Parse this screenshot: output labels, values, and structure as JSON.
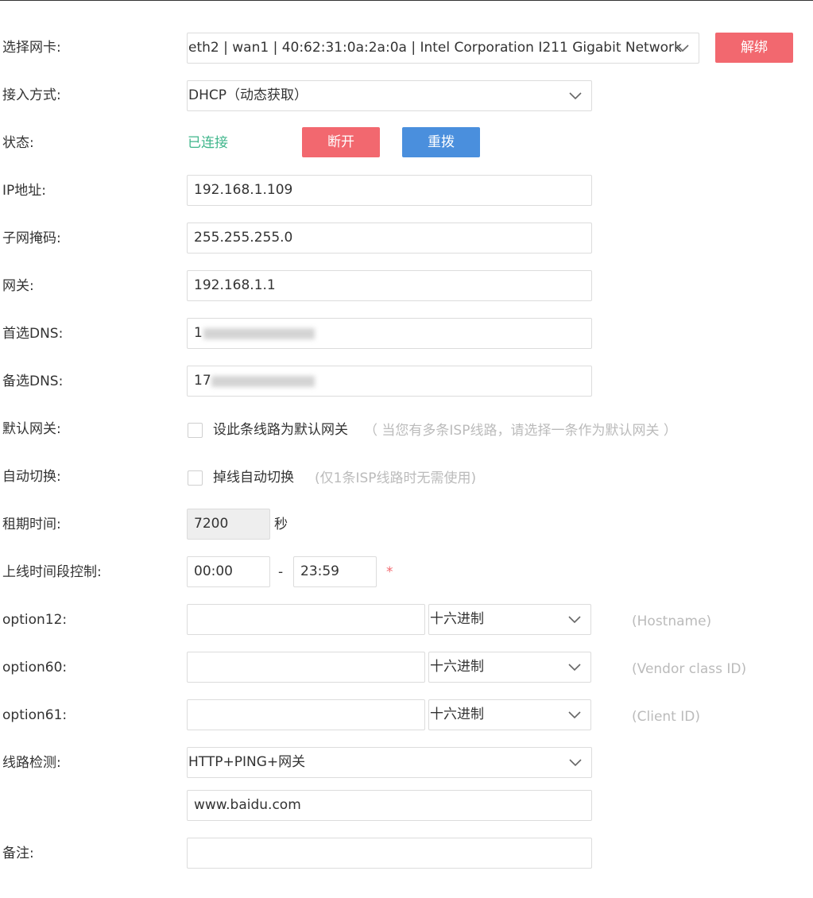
{
  "labels": {
    "nic": "选择网卡:",
    "access": "接入方式:",
    "status": "状态:",
    "ip": "IP地址:",
    "mask": "子网掩码:",
    "gateway": "网关:",
    "dns1": "首选DNS:",
    "dns2": "备选DNS:",
    "default_gw": "默认网关:",
    "auto_switch": "自动切换:",
    "lease": "租期时间:",
    "online_time": "上线时间段控制:",
    "option12": "option12:",
    "option60": "option60:",
    "option61": "option61:",
    "line_check": "线路检测:",
    "remark": "备注:"
  },
  "nic": {
    "selected": "eth2 | wan1 | 40:62:31:0a:2a:0a | Intel Corporation I211 Gigabit Network",
    "unbind_label": "解绑"
  },
  "access": {
    "selected": "DHCP（动态获取）"
  },
  "status": {
    "text": "已连接",
    "disconnect_label": "断开",
    "redial_label": "重拨"
  },
  "ip": {
    "value": "192.168.1.109"
  },
  "mask": {
    "value": "255.255.255.0"
  },
  "gateway": {
    "value": "192.168.1.1"
  },
  "dns1": {
    "value_visible": "1"
  },
  "dns2": {
    "value_visible": "17"
  },
  "default_gw": {
    "checked": false,
    "label": "设此条线路为默认网关",
    "hint": "（ 当您有多条ISP线路，请选择一条作为默认网关 ）"
  },
  "auto_switch": {
    "checked": false,
    "label": "掉线自动切换",
    "hint": "(仅1条ISP线路时无需使用)"
  },
  "lease": {
    "value": "7200",
    "unit": "秒"
  },
  "online_time": {
    "start": "00:00",
    "separator": "-",
    "end": "23:59",
    "required_mark": "*"
  },
  "option12": {
    "value": "",
    "encoding": "十六进制",
    "hint": "(Hostname)"
  },
  "option60": {
    "value": "",
    "encoding": "十六进制",
    "hint": "(Vendor class ID)"
  },
  "option61": {
    "value": "",
    "encoding": "十六进制",
    "hint": "(Client ID)"
  },
  "line_check": {
    "selected": "HTTP+PING+网关",
    "url": "www.baidu.com"
  },
  "remark": {
    "value": ""
  },
  "colors": {
    "danger": "#f2686f",
    "primary": "#4a8fdd",
    "success": "#3fb68b",
    "hint": "#bbbbbb"
  },
  "icons": {
    "dropdown": "chevron-down-icon",
    "checkbox": "checkbox-unchecked-icon"
  }
}
